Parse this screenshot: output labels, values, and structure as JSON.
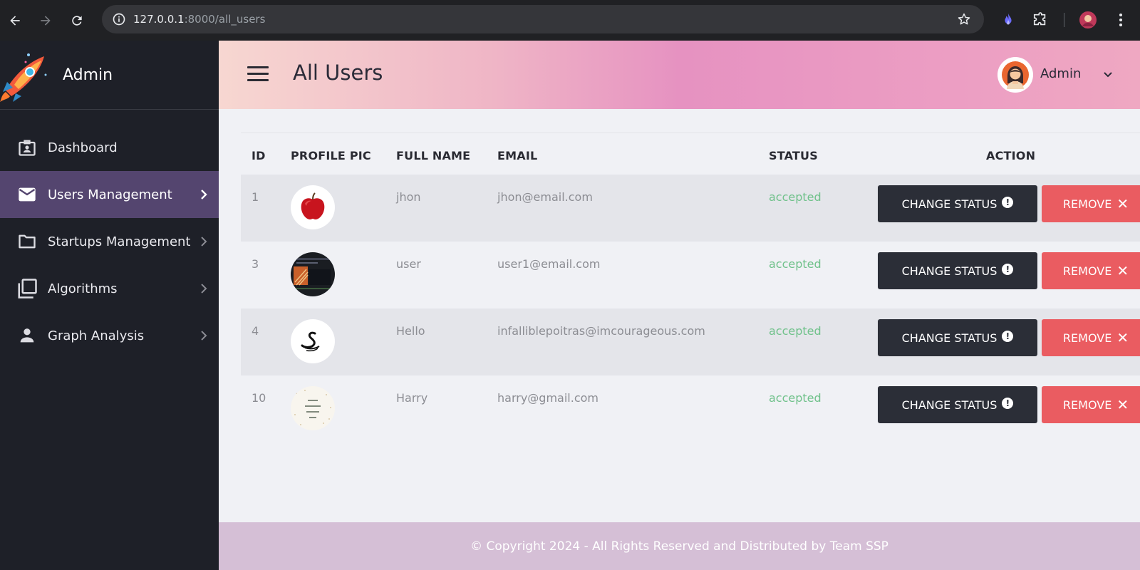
{
  "browser": {
    "url_host": "127.0.0.1",
    "url_path": ":8000/all_users"
  },
  "sidebar": {
    "brand": "Admin",
    "items": [
      {
        "label": "Dashboard",
        "icon": "badge-icon",
        "active": false,
        "chevron": false
      },
      {
        "label": "Users Management",
        "icon": "mail-icon",
        "active": true,
        "chevron": true
      },
      {
        "label": "Startups Management",
        "icon": "folder-icon",
        "active": false,
        "chevron": true
      },
      {
        "label": "Algorithms",
        "icon": "library-icon",
        "active": false,
        "chevron": true
      },
      {
        "label": "Graph Analysis",
        "icon": "person-icon",
        "active": false,
        "chevron": true
      }
    ]
  },
  "header": {
    "title": "All Users",
    "user_name": "Admin"
  },
  "table": {
    "columns": [
      "ID",
      "PROFILE PIC",
      "FULL NAME",
      "EMAIL",
      "STATUS",
      "ACTION"
    ],
    "rows": [
      {
        "id": "1",
        "pic": "apple",
        "name": "jhon",
        "email": "jhon@email.com",
        "status": "accepted"
      },
      {
        "id": "3",
        "pic": "screenshot",
        "name": "user",
        "email": "user1@email.com",
        "status": "accepted"
      },
      {
        "id": "4",
        "pic": "swan-logo",
        "name": "Hello",
        "email": "infalliblepoitras@imcourageous.com",
        "status": "accepted"
      },
      {
        "id": "10",
        "pic": "handwritten-card",
        "name": "Harry",
        "email": "harry@gmail.com",
        "status": "accepted"
      }
    ],
    "change_status_label": "CHANGE STATUS",
    "remove_label": "REMOVE"
  },
  "footer": {
    "text": "© Copyright 2024 - All Rights Reserved and Distributed by Team SSP"
  },
  "colors": {
    "sidebar_bg": "#1e2028",
    "active_item": "#54456f",
    "status_accepted": "#6fc18a",
    "change_btn": "#2b2e37",
    "remove_btn": "#ea5c61",
    "footer_bg": "#d5bfd6"
  }
}
